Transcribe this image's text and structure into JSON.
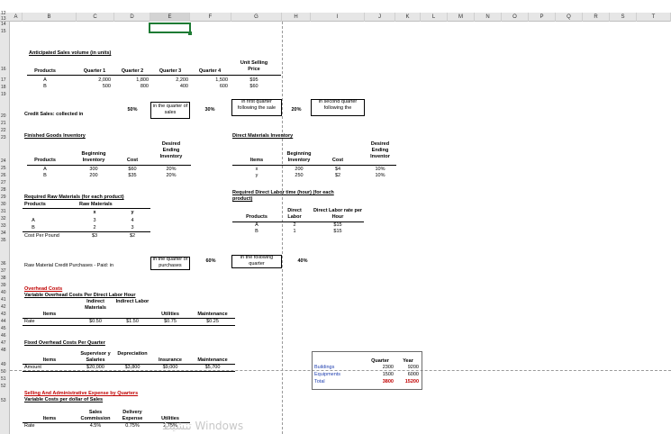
{
  "columns": [
    "A",
    "B",
    "C",
    "D",
    "E",
    "F",
    "G",
    "H",
    "I",
    "J",
    "K",
    "L",
    "M",
    "N",
    "O",
    "P",
    "Q",
    "R",
    "S",
    "T"
  ],
  "rows": [
    "12",
    "13",
    "14",
    "15",
    "16",
    "17",
    "18",
    "19",
    "20",
    "21",
    "22",
    "23",
    "24",
    "25",
    "26",
    "27",
    "28",
    "29",
    "30",
    "31",
    "32",
    "33",
    "34",
    "35",
    "36",
    "37",
    "38",
    "39",
    "40",
    "41",
    "42",
    "43",
    "44",
    "45",
    "46",
    "47",
    "48",
    "49",
    "50",
    "51",
    "52",
    "53"
  ],
  "sales": {
    "title": "Anticipated Sales volume (in units)",
    "headers": [
      "Products",
      "Quarter 1",
      "Quarter 2",
      "Quarter 3",
      "Quarter 4",
      "Unit Selling Price"
    ],
    "rows": [
      {
        "product": "A",
        "q1": "2,000",
        "q2": "1,800",
        "q3": "2,200",
        "q4": "1,500",
        "price": "$95"
      },
      {
        "product": "B",
        "q1": "500",
        "q2": "800",
        "q3": "400",
        "q4": "600",
        "price": "$60"
      }
    ]
  },
  "credit_sales": {
    "label": "Credit Sales: collected in",
    "pct1": "50%",
    "note1": "in the quarter of sales",
    "pct2": "30%",
    "note2": "in first quarter following the sale",
    "pct3": "20%",
    "note3": "in second quarter following the"
  },
  "finished_goods": {
    "title": "Finished Goods Inventory",
    "headers": [
      "Products",
      "Beginning Inventory",
      "Cost",
      "Desired Ending Inventory"
    ],
    "rows": [
      {
        "product": "A",
        "beg": "300",
        "cost": "$60",
        "desired": "20%"
      },
      {
        "product": "B",
        "beg": "200",
        "cost": "$35",
        "desired": "20%"
      }
    ]
  },
  "direct_materials": {
    "title": "Direct Materials Inventory",
    "headers": [
      "Items",
      "Beginning Inventory",
      "Cost",
      "Desired Ending Inventor"
    ],
    "rows": [
      {
        "item": "x",
        "beg": "200",
        "cost": "$4",
        "desired": "10%"
      },
      {
        "item": "y",
        "beg": "250",
        "cost": "$2",
        "desired": "10%"
      }
    ]
  },
  "raw_materials": {
    "title": "Required Raw Materials (for each product)",
    "products_label": "Products",
    "raw_label": "Raw Materials",
    "cols": [
      "x",
      "y"
    ],
    "rows": [
      {
        "product": "A",
        "x": "3",
        "y": "4"
      },
      {
        "product": "B",
        "x": "2",
        "y": "3"
      }
    ],
    "cost_label": "Cost Per Pound",
    "cost_x": "$3",
    "cost_y": "$2"
  },
  "direct_labor": {
    "title": "Required Direct Labor time (hour) (for each product)",
    "headers": [
      "Products",
      "Direct Labor",
      "Direct Labor rate per Hour"
    ],
    "rows": [
      {
        "product": "A",
        "labor": "2",
        "rate": "$15"
      },
      {
        "product": "B",
        "labor": "1",
        "rate": "$15"
      }
    ]
  },
  "raw_purchases": {
    "label": "Raw Material Credit Purchases - Paid: in",
    "note1": "in the quarter of purchases",
    "pct1": "60%",
    "note2": "in the following quarter",
    "pct2": "40%"
  },
  "overhead": {
    "title1": "Overhead Costs",
    "title2": "Variable Overhead Costs Per Direct Labor Hour",
    "headers": [
      "Items",
      "Indirect Materials",
      "Indirect Labor",
      "Utilities",
      "Maintenance"
    ],
    "rate_label": "Rate",
    "values": [
      "$0.50",
      "$1.50",
      "$0.75",
      "$0.25"
    ]
  },
  "fixed_overhead": {
    "title": "Fixed Overhead Costs Per Quarter",
    "headers": [
      "Items",
      "Supervisor y Salaries",
      "Depreciation",
      "Insurance",
      "Maintenance"
    ],
    "amount_label": "Amount",
    "values": [
      "$20,000",
      "$3,800",
      "$9,000",
      "$5,700"
    ]
  },
  "depreciation_table": {
    "headers": [
      "Quarter",
      "Year"
    ],
    "rows": [
      {
        "label": "Buildings",
        "quarter": "2300",
        "year": "9200"
      },
      {
        "label": "Equipments",
        "quarter": "1500",
        "year": "6000"
      },
      {
        "label": "Total",
        "quarter": "3800",
        "year": "15200"
      }
    ]
  },
  "selling_admin": {
    "title1": "Selling And Administrative Expense by Quarters",
    "title2": "Variable Costs per dollar of Sales",
    "headers": [
      "Items",
      "Sales Commission",
      "Delivery Expense",
      "Utilities"
    ],
    "rate_label": "Rate",
    "values": [
      "4.5%",
      "0.75%",
      "2.75%"
    ]
  },
  "watermark": "تنشيط Windows",
  "colors": {
    "grid_header": "#e6e6e6",
    "selection": "#1e7b34",
    "red_text": "#c00000"
  }
}
